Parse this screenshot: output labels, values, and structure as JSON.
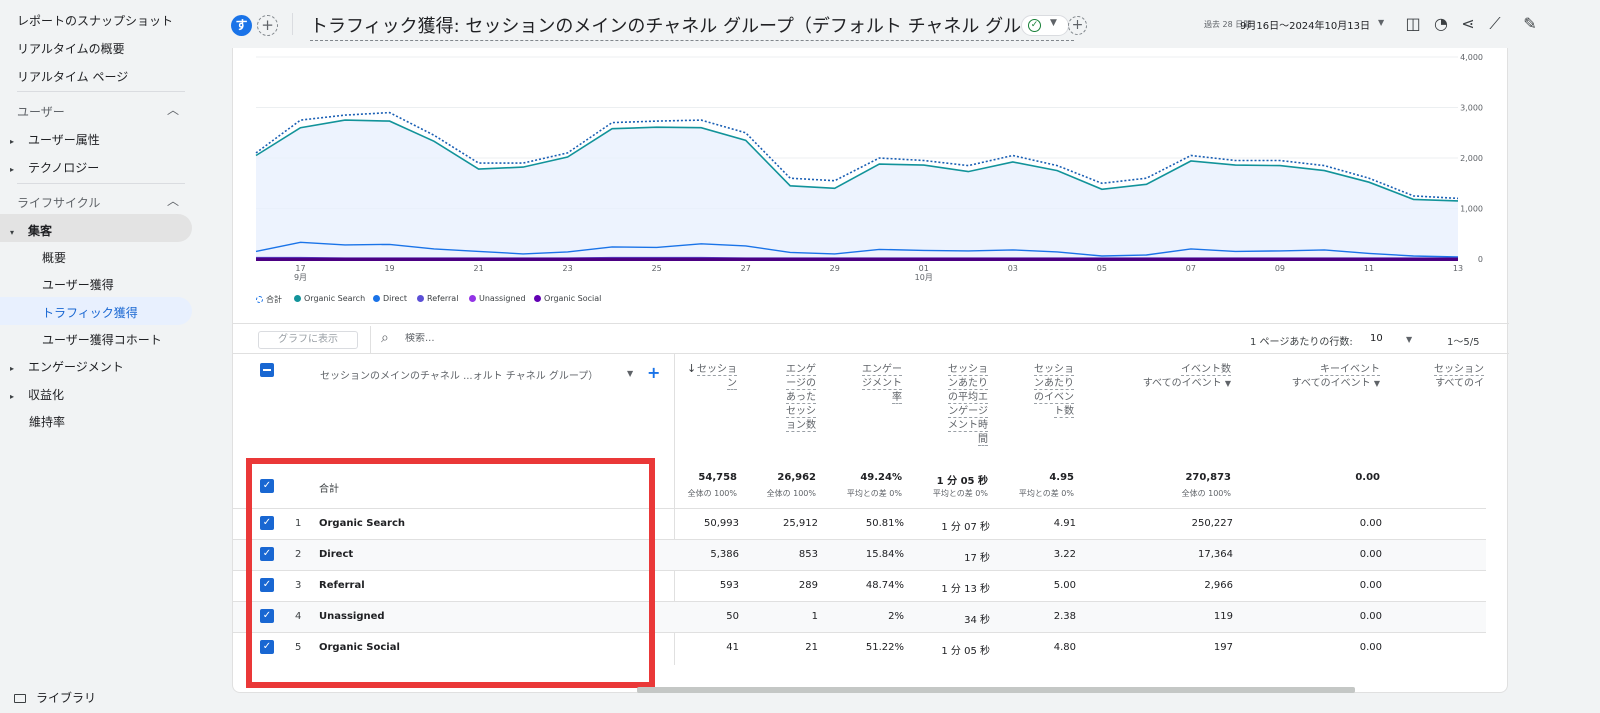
{
  "sidebar": {
    "top_links": [
      "レポートのスナップショット",
      "リアルタイムの概要",
      "リアルタイム ページ"
    ],
    "section_user": "ユーザー",
    "user_items": [
      "ユーザー属性",
      "テクノロジー"
    ],
    "section_lifecycle": "ライフサイクル",
    "acquisition": "集客",
    "acq_items": [
      "概要",
      "ユーザー獲得",
      "トラフィック獲得",
      "ユーザー獲得コホート"
    ],
    "engagement": "エンゲージメント",
    "monetization": "収益化",
    "retention": "維持率",
    "library": "ライブラリ"
  },
  "header": {
    "avatar": "す",
    "title": "トラフィック獲得: セッションのメインのチャネル グループ（デフォルト チャネル グループ）",
    "date_prefix": "過去 28 日間",
    "date_range": "9月16日～2024年10月13日"
  },
  "colors": {
    "accent": "#1a73e8",
    "organic_search": "#12939a",
    "direct": "#1a73e8",
    "referral": "#5b4fd6",
    "unassigned": "#9334e6",
    "organic_social": "#6200b3",
    "highlight": "#ea3838"
  },
  "chart_data": {
    "type": "line",
    "x": [
      "9/16",
      "9/17",
      "9/18",
      "9/19",
      "9/20",
      "9/21",
      "9/22",
      "9/23",
      "9/24",
      "9/25",
      "9/26",
      "9/27",
      "9/28",
      "9/29",
      "9/30",
      "10/01",
      "10/02",
      "10/03",
      "10/04",
      "10/05",
      "10/06",
      "10/07",
      "10/08",
      "10/09",
      "10/10",
      "10/11",
      "10/12",
      "10/13"
    ],
    "x_tick_labels": [
      "17",
      "19",
      "21",
      "23",
      "25",
      "27",
      "29",
      "01",
      "03",
      "05",
      "07",
      "09",
      "11",
      "13"
    ],
    "x_month_labels": [
      "9月",
      "10月"
    ],
    "y_tick_labels": [
      "0",
      "1,000",
      "2,000",
      "3,000",
      "4,000"
    ],
    "ylim": [
      0,
      4000
    ],
    "series": [
      {
        "name": "合計",
        "style": "dotted",
        "values": [
          2100,
          2750,
          2850,
          2900,
          2450,
          1900,
          1900,
          2100,
          2700,
          2730,
          2750,
          2500,
          1600,
          1550,
          2000,
          1950,
          1850,
          2050,
          1850,
          1500,
          1600,
          2050,
          1950,
          1950,
          1850,
          1600,
          1250,
          1200
        ]
      },
      {
        "name": "Organic Search",
        "values": [
          2050,
          2600,
          2750,
          2730,
          2330,
          1780,
          1820,
          2020,
          2580,
          2610,
          2600,
          2350,
          1450,
          1400,
          1880,
          1860,
          1730,
          1920,
          1750,
          1380,
          1480,
          1940,
          1860,
          1850,
          1750,
          1520,
          1180,
          1150
        ]
      },
      {
        "name": "Direct",
        "values": [
          150,
          330,
          280,
          290,
          200,
          150,
          100,
          140,
          240,
          230,
          300,
          260,
          130,
          100,
          190,
          170,
          160,
          180,
          140,
          60,
          80,
          200,
          150,
          160,
          180,
          110,
          60,
          40
        ]
      },
      {
        "name": "Referral",
        "values": [
          30,
          30,
          20,
          20,
          20,
          20,
          20,
          20,
          30,
          30,
          30,
          20,
          20,
          20,
          20,
          20,
          20,
          20,
          20,
          20,
          20,
          20,
          20,
          20,
          20,
          20,
          20,
          20
        ]
      },
      {
        "name": "Unassigned",
        "values": [
          5,
          5,
          5,
          5,
          5,
          5,
          5,
          5,
          5,
          5,
          5,
          5,
          5,
          5,
          5,
          5,
          5,
          5,
          5,
          5,
          5,
          5,
          5,
          5,
          5,
          5,
          5,
          5
        ]
      },
      {
        "name": "Organic Social",
        "values": [
          5,
          5,
          5,
          5,
          5,
          5,
          5,
          5,
          5,
          5,
          5,
          5,
          5,
          5,
          5,
          5,
          5,
          5,
          5,
          5,
          5,
          5,
          5,
          5,
          5,
          5,
          5,
          5
        ]
      }
    ],
    "legend": [
      "合計",
      "Organic Search",
      "Direct",
      "Referral",
      "Unassigned",
      "Organic Social"
    ]
  },
  "toolbar": {
    "plot_button": "グラフに表示",
    "search_placeholder": "検索...",
    "rows_per_page_label": "1 ページあたりの行数:",
    "rows_per_page": "10",
    "pagination": "1～5/5"
  },
  "table": {
    "dim_header": "セッションのメインのチャネル ...ォルト チャネル グループ）",
    "headers": [
      {
        "lines": [
          "セッショ",
          "ン"
        ]
      },
      {
        "lines": [
          "エンゲ",
          "ージの",
          "あった",
          "セッシ",
          "ョン数"
        ]
      },
      {
        "lines": [
          "エンゲー",
          "ジメント",
          "率"
        ]
      },
      {
        "lines": [
          "セッショ",
          "ンあたり",
          "の平均エ",
          "ンゲージ",
          "メント時",
          "間"
        ]
      },
      {
        "lines": [
          "セッショ",
          "ンあたり",
          "のイベン",
          "ト数"
        ]
      },
      {
        "lines": [
          "イベント数"
        ],
        "sub": "すべてのイベント"
      },
      {
        "lines": [
          "キーイベント"
        ],
        "sub": "すべてのイベント"
      },
      {
        "lines": [
          "セッション"
        ],
        "sub": "すべてのイ"
      }
    ],
    "total": {
      "label": "合計",
      "values": [
        "54,758",
        "26,962",
        "49.24%",
        "1 分 05 秒",
        "4.95",
        "270,873",
        "0.00"
      ],
      "subs": [
        "全体の 100%",
        "全体の 100%",
        "平均との差 0%",
        "平均との差 0%",
        "平均との差 0%",
        "全体の 100%",
        ""
      ]
    },
    "rows": [
      {
        "n": "1",
        "name": "Organic Search",
        "values": [
          "50,993",
          "25,912",
          "50.81%",
          "1 分 07 秒",
          "4.91",
          "250,227",
          "0.00"
        ]
      },
      {
        "n": "2",
        "name": "Direct",
        "values": [
          "5,386",
          "853",
          "15.84%",
          "17 秒",
          "3.22",
          "17,364",
          "0.00"
        ]
      },
      {
        "n": "3",
        "name": "Referral",
        "values": [
          "593",
          "289",
          "48.74%",
          "1 分 13 秒",
          "5.00",
          "2,966",
          "0.00"
        ]
      },
      {
        "n": "4",
        "name": "Unassigned",
        "values": [
          "50",
          "1",
          "2%",
          "34 秒",
          "2.38",
          "119",
          "0.00"
        ]
      },
      {
        "n": "5",
        "name": "Organic Social",
        "values": [
          "41",
          "21",
          "51.22%",
          "1 分 05 秒",
          "4.80",
          "197",
          "0.00"
        ]
      }
    ]
  }
}
